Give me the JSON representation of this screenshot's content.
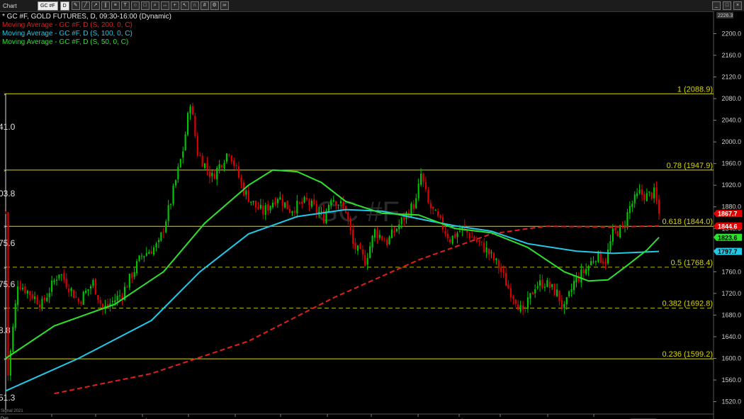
{
  "toolbar": {
    "title": "Chart",
    "symbol": "GC #F",
    "interval": "D",
    "buttons": [
      "pencil-icon",
      "line-icon",
      "ray-icon",
      "channel-icon",
      "fib-icon",
      "text-icon",
      "circle-icon",
      "rectangle-icon",
      "zoom-icon",
      "measure-icon",
      "crosshair-icon",
      "pointer-icon",
      "magnet-icon",
      "grid-icon",
      "settings-icon",
      "link-icon"
    ],
    "window_buttons": [
      "minimize-icon",
      "maximize-icon",
      "close-icon"
    ]
  },
  "legend": {
    "main": "* GC #F, GOLD FUTURES, D, 09:30-16:00 (Dynamic)",
    "ma200": "Moving Average - GC #F, D (S, 200, 0, C)",
    "ma100": "Moving Average - GC #F, D (S, 100, 0, C)",
    "ma50": "Moving Average - GC #F, D (S, 50, 0, C)"
  },
  "watermark": "GC #F",
  "left_labels": [
    "41.0",
    "03.8",
    "75.6",
    "75.6",
    "8.8",
    "51.3"
  ],
  "bottom_left_labels": [
    "Dyn",
    "Signal 2021"
  ],
  "colors": {
    "up": "#00c800",
    "down": "#e00000",
    "ma200": "#e11e1e",
    "ma100": "#22c8e6",
    "ma50": "#2ee02e",
    "fib": "#d8d800",
    "fib_dashed": "#b8b800",
    "axis_text": "#d0d0d0",
    "tag_last": "#e00000",
    "tag_ma200": "#e00000",
    "tag_ma50": "#2ee02e",
    "tag_ma100": "#22c8e6"
  },
  "chart_data": {
    "type": "candlestick",
    "title": "GC #F, GOLD FUTURES, D, 09:30-16:00 (Dynamic)",
    "ylim": [
      1505,
      2236
    ],
    "y_ticks": [
      1520.0,
      1560.0,
      1600.0,
      1640.0,
      1680.0,
      1720.0,
      1760.0,
      1800.0,
      1840.0,
      1880.0,
      1920.0,
      1960.0,
      2000.0,
      2040.0,
      2080.0,
      2120.0,
      2160.0,
      2200.0
    ],
    "y_top_label": "2226.3",
    "x_labels": [
      "May",
      "Jun",
      "Jul",
      "Aug",
      "Sep",
      "Oct",
      "Nov",
      "Dec",
      "2021",
      "Feb",
      "Mar",
      "Apr",
      "May"
    ],
    "x_current_date": "06/03/2021",
    "price_path": [
      [
        1,
        1570
      ],
      [
        5,
        1740
      ],
      [
        15,
        1700
      ],
      [
        22,
        1760
      ],
      [
        30,
        1705
      ],
      [
        36,
        1740
      ],
      [
        40,
        1690
      ],
      [
        48,
        1720
      ],
      [
        56,
        1790
      ],
      [
        63,
        1810
      ],
      [
        68,
        1890
      ],
      [
        73,
        1985
      ],
      [
        76,
        2075
      ],
      [
        79,
        1980
      ],
      [
        85,
        1935
      ],
      [
        92,
        1985
      ],
      [
        98,
        1910
      ],
      [
        103,
        1880
      ],
      [
        106,
        1870
      ],
      [
        112,
        1900
      ],
      [
        117,
        1875
      ],
      [
        124,
        1890
      ],
      [
        131,
        1860
      ],
      [
        134,
        1900
      ],
      [
        140,
        1875
      ],
      [
        143,
        1810
      ],
      [
        148,
        1780
      ],
      [
        152,
        1835
      ],
      [
        157,
        1815
      ],
      [
        164,
        1860
      ],
      [
        169,
        1890
      ],
      [
        171,
        1940
      ],
      [
        174,
        1885
      ],
      [
        179,
        1850
      ],
      [
        183,
        1820
      ],
      [
        188,
        1840
      ],
      [
        193,
        1820
      ],
      [
        198,
        1800
      ],
      [
        203,
        1770
      ],
      [
        207,
        1730
      ],
      [
        210,
        1710
      ],
      [
        213,
        1680
      ],
      [
        218,
        1735
      ],
      [
        222,
        1740
      ],
      [
        227,
        1720
      ],
      [
        230,
        1690
      ],
      [
        234,
        1740
      ],
      [
        239,
        1765
      ],
      [
        243,
        1790
      ],
      [
        247,
        1780
      ],
      [
        250,
        1830
      ],
      [
        254,
        1840
      ],
      [
        257,
        1880
      ],
      [
        261,
        1905
      ],
      [
        264,
        1900
      ],
      [
        267,
        1905
      ],
      [
        269,
        1870
      ]
    ],
    "n_bars": 270,
    "last_price": 1867.7,
    "price_tags": [
      {
        "name": "last",
        "value": 1867.7,
        "label": "1867.7"
      },
      {
        "name": "ma200",
        "value": 1844.6,
        "label": "1844.6"
      },
      {
        "name": "ma50",
        "value": 1823.6,
        "label": "1823.6"
      },
      {
        "name": "ma100",
        "value": 1797.7,
        "label": "1797.7"
      }
    ],
    "fibonacci_levels": [
      {
        "ratio": "1",
        "value": 2088.9,
        "label": "1 (2088.9)",
        "style": "solid"
      },
      {
        "ratio": "0.78",
        "value": 1947.9,
        "label": "0.78 (1947.9)",
        "style": "solid"
      },
      {
        "ratio": "0.618",
        "value": 1844.0,
        "label": "0.618 (1844.0)",
        "style": "solid"
      },
      {
        "ratio": "0.5",
        "value": 1768.4,
        "label": "0.5 (1768.4)",
        "style": "dashed"
      },
      {
        "ratio": "0.382",
        "value": 1692.8,
        "label": "0.382 (1692.8)",
        "style": "dashed"
      },
      {
        "ratio": "0.236",
        "value": 1599.2,
        "label": "0.236 (1599.2)",
        "style": "solid"
      }
    ],
    "moving_averages": [
      {
        "name": "Moving Average - GC #F, D (S, 200, 0, C)",
        "period": 200,
        "color": "#e11e1e",
        "style": "dashed",
        "points": [
          [
            20,
            1535
          ],
          [
            60,
            1572
          ],
          [
            100,
            1632
          ],
          [
            135,
            1712
          ],
          [
            170,
            1782
          ],
          [
            200,
            1830
          ],
          [
            222,
            1844
          ],
          [
            250,
            1843
          ],
          [
            269,
            1844.6
          ]
        ]
      },
      {
        "name": "Moving Average - GC #F, D (S, 100, 0, C)",
        "period": 100,
        "color": "#22c8e6",
        "style": "solid",
        "points": [
          [
            0,
            1540
          ],
          [
            30,
            1600
          ],
          [
            60,
            1670
          ],
          [
            80,
            1760
          ],
          [
            100,
            1830
          ],
          [
            120,
            1862
          ],
          [
            140,
            1875
          ],
          [
            155,
            1872
          ],
          [
            170,
            1858
          ],
          [
            185,
            1845
          ],
          [
            200,
            1835
          ],
          [
            215,
            1812
          ],
          [
            235,
            1798
          ],
          [
            250,
            1794
          ],
          [
            269,
            1797.7
          ]
        ]
      },
      {
        "name": "Moving Average - GC #F, D (S, 50, 0, C)",
        "period": 50,
        "color": "#2ee02e",
        "style": "solid",
        "points": [
          [
            0,
            1600
          ],
          [
            20,
            1660
          ],
          [
            45,
            1700
          ],
          [
            65,
            1760
          ],
          [
            82,
            1850
          ],
          [
            100,
            1920
          ],
          [
            110,
            1948
          ],
          [
            120,
            1945
          ],
          [
            130,
            1925
          ],
          [
            140,
            1890
          ],
          [
            155,
            1868
          ],
          [
            170,
            1865
          ],
          [
            185,
            1840
          ],
          [
            200,
            1832
          ],
          [
            215,
            1805
          ],
          [
            230,
            1760
          ],
          [
            240,
            1743
          ],
          [
            248,
            1745
          ],
          [
            256,
            1772
          ],
          [
            264,
            1800
          ],
          [
            269,
            1823.6
          ]
        ]
      }
    ]
  }
}
